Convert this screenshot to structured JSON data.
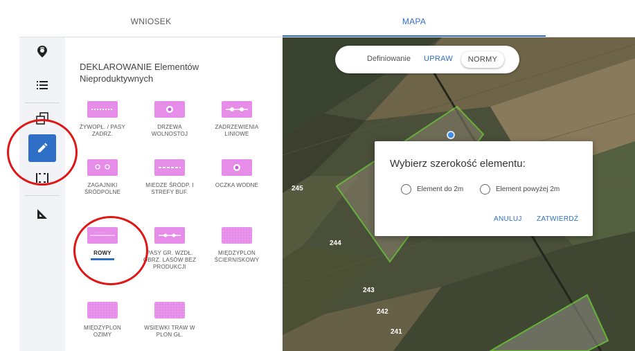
{
  "tabs": {
    "wniosek": "WNIOSEK",
    "mapa": "MAPA"
  },
  "rail": {
    "icons": [
      "plant-pin-icon",
      "list-icon",
      "copy-shapes-icon",
      "edit-pencil-icon",
      "dashed-line-icon",
      "measure-ruler-icon"
    ]
  },
  "panel": {
    "title": "DEKLAROWANIE Elementów Nieproduktywnych",
    "items": [
      {
        "label": "ŻYWOPŁ. / PASY ZADRZ."
      },
      {
        "label": "DRZEWA WOLNOSTOJ"
      },
      {
        "label": "ZADRZEWIENIA LINIOWE"
      },
      {
        "label": "ZAGAJNIKI ŚRÓDPOLNE"
      },
      {
        "label": "MIEDZE ŚRÓDP. I STREFY BUF."
      },
      {
        "label": "OCZKA WODNE"
      },
      {
        "label": "ROWY"
      },
      {
        "label": "PASY GR. WZDŁ. OBRZ. LASÓW BEZ PRODUKCJI"
      },
      {
        "label": "MIĘDZYPLON ŚCIERNISKOWY"
      },
      {
        "label": "MIĘDZYPLON OZIMY"
      },
      {
        "label": "WSIEWKI TRAW W PLON GŁ."
      }
    ]
  },
  "map": {
    "toggle": {
      "label": "Definiowanie",
      "upraw": "UPRAW",
      "normy": "NORMY"
    },
    "parcels": [
      "245",
      "244",
      "243",
      "242",
      "241"
    ]
  },
  "dialog": {
    "title": "Wybierz szerokość elementu:",
    "option1": "Element do 2m",
    "option2": "Element powyżej 2m",
    "cancel": "ANULUJ",
    "confirm": "ZATWIERDŹ"
  },
  "colors": {
    "accent": "#2f6fc6",
    "thumb": "#e58de8",
    "parcelOutline": "#7dff3a",
    "annotation": "#e01515"
  }
}
